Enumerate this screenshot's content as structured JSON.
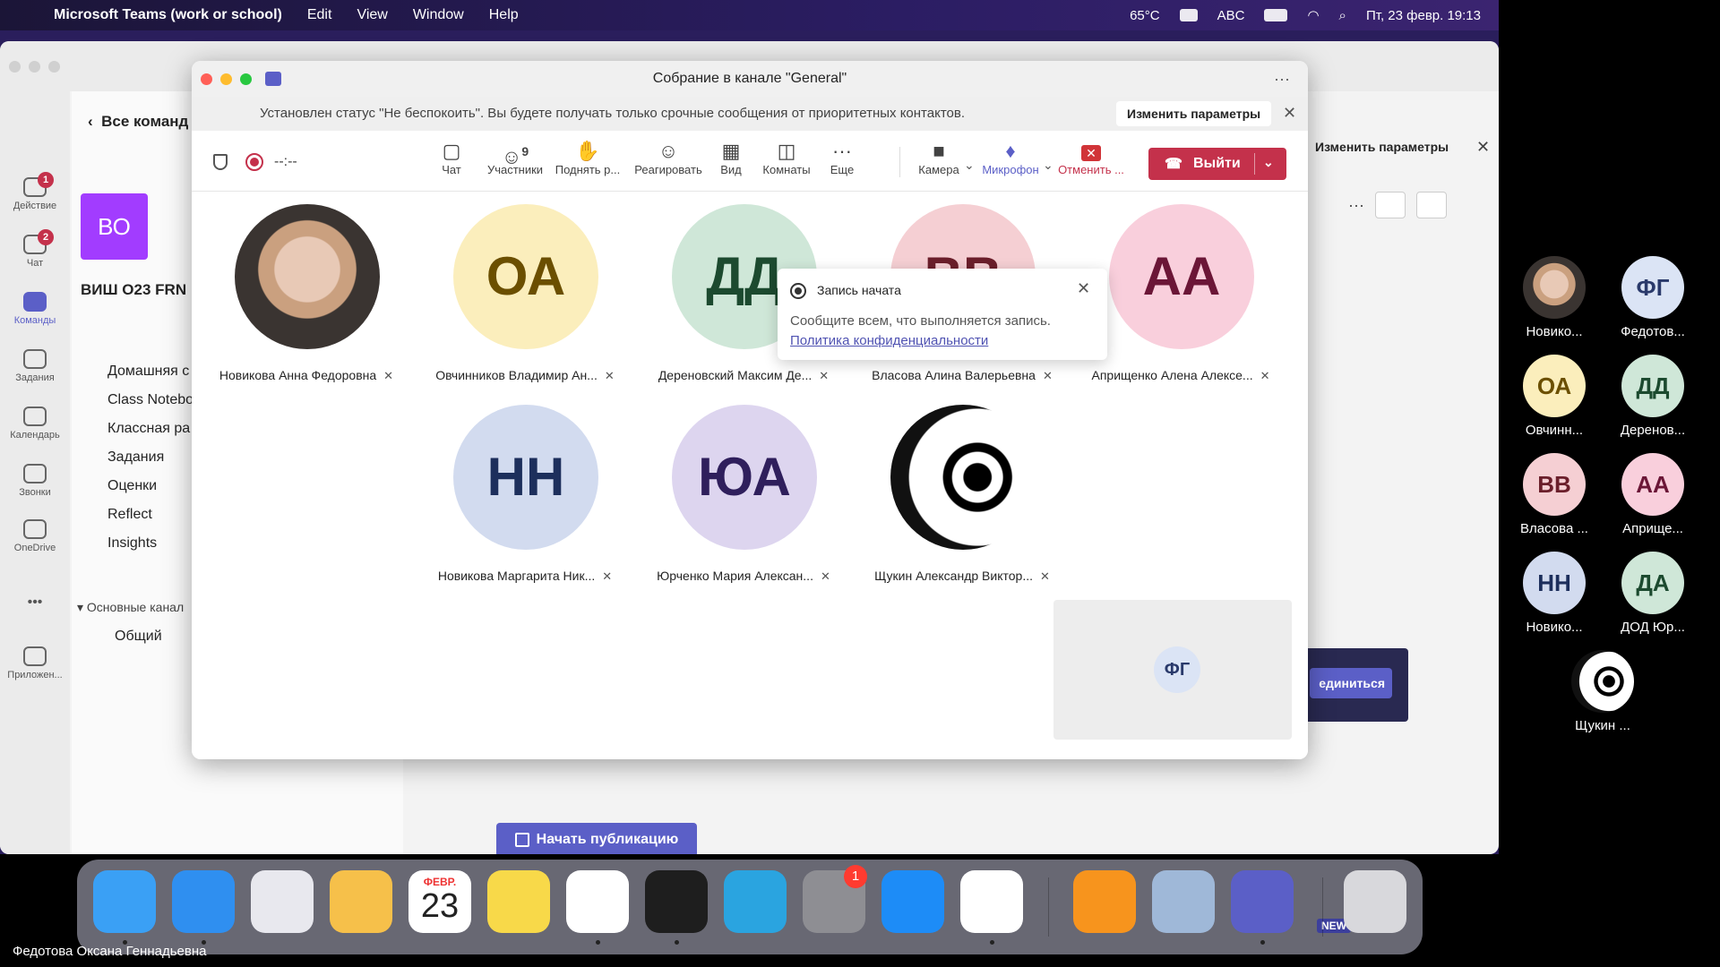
{
  "menubar": {
    "app_name": "Microsoft Teams (work or school)",
    "items": [
      "Edit",
      "View",
      "Window",
      "Help"
    ],
    "temperature": "65°C",
    "input_source": "ABC",
    "datetime": "Пт, 23 февр. 19:13"
  },
  "teams_main": {
    "rail": [
      {
        "label": "Действие",
        "icon": "bell-icon",
        "badge": "1"
      },
      {
        "label": "Чат",
        "icon": "chat-icon",
        "badge": "2"
      },
      {
        "label": "Команды",
        "icon": "teams-icon",
        "badge": ""
      },
      {
        "label": "Задания",
        "icon": "assignments-icon",
        "badge": ""
      },
      {
        "label": "Календарь",
        "icon": "calendar-icon",
        "badge": ""
      },
      {
        "label": "Звонки",
        "icon": "phone-icon",
        "badge": ""
      },
      {
        "label": "OneDrive",
        "icon": "cloud-icon",
        "badge": ""
      },
      {
        "label": "•••",
        "icon": "more-icon",
        "badge": ""
      },
      {
        "label": "Приложен...",
        "icon": "add-apps-icon",
        "badge": ""
      }
    ],
    "back_label": "Все команд",
    "team_avatar": "ВО",
    "team_name": "ВИШ О23 FRN",
    "nav_items": [
      "Домашняя с",
      "Class Notebo",
      "Классная ра",
      "Задания",
      "Оценки",
      "Reflect",
      "Insights"
    ],
    "section_label": "Основные канал",
    "channel": "Общий",
    "publish_button": "Начать публикацию",
    "right_change_params": "Изменить параметры",
    "join_label": "единиться"
  },
  "meeting": {
    "title": "Собрание в канале \"General\"",
    "dnd_message": "Установлен статус \"Не беспокоить\". Вы будете получать только срочные сообщения от приоритетных контактов.",
    "dnd_button": "Изменить параметры",
    "timer": "--:--",
    "toolbar": {
      "chat": "Чат",
      "participants": "Участники",
      "participants_count": "9",
      "raise_hand": "Поднять р...",
      "react": "Реагировать",
      "view": "Вид",
      "rooms": "Комнаты",
      "more": "Еще",
      "camera": "Камера",
      "mic": "Микрофон",
      "cancel": "Отменить ...",
      "leave": "Выйти"
    },
    "recording_popup": {
      "title": "Запись начата",
      "text": "Сообщите всем, что выполняется запись.",
      "link": "Политика конфиденциальности"
    },
    "participants": [
      {
        "initials": "",
        "name": "Новикова Анна Федоровна",
        "bg": "#3a3431",
        "fg": "#3a3431",
        "photo": "woman"
      },
      {
        "initials": "ОА",
        "name": "Овчинников Владимир Ан...",
        "bg": "#fbeebc",
        "fg": "#6b4f00",
        "photo": ""
      },
      {
        "initials": "ДД",
        "name": "Дереновский Максим Де...",
        "bg": "#cfe7d8",
        "fg": "#1c4a2f",
        "photo": ""
      },
      {
        "initials": "ВВ",
        "name": "Власова Алина Валерьевна",
        "bg": "#f5cfd3",
        "fg": "#6b1f2b",
        "photo": ""
      },
      {
        "initials": "АА",
        "name": "Априщенко Алена Алексе...",
        "bg": "#f9cfdc",
        "fg": "#6b1637",
        "photo": ""
      },
      {
        "initials": "НН",
        "name": "Новикова Маргарита Ник...",
        "bg": "#d2dbef",
        "fg": "#1d2f5c",
        "photo": ""
      },
      {
        "initials": "ЮА",
        "name": "Юрченко Мария Алексан...",
        "bg": "#ddd5ef",
        "fg": "#2f1f5c",
        "photo": ""
      },
      {
        "initials": "",
        "name": "Щукин Александр Виктор...",
        "bg": "#ffffff",
        "fg": "#000000",
        "photo": "eye"
      }
    ],
    "self_view": "ФГ"
  },
  "strip": [
    {
      "initials": "",
      "name": "Новико...",
      "bg": "#caa07f",
      "fg": "#333",
      "photo": "woman"
    },
    {
      "initials": "ФГ",
      "name": "Федотов...",
      "bg": "#dbe4f5",
      "fg": "#2a3a6b",
      "photo": ""
    },
    {
      "initials": "ОА",
      "name": "Овчинн...",
      "bg": "#fbeebc",
      "fg": "#6b4f00",
      "photo": ""
    },
    {
      "initials": "ДД",
      "name": "Деренов...",
      "bg": "#cfe7d8",
      "fg": "#1c4a2f",
      "photo": ""
    },
    {
      "initials": "ВВ",
      "name": "Власова ...",
      "bg": "#f5cfd3",
      "fg": "#6b1f2b",
      "photo": ""
    },
    {
      "initials": "АА",
      "name": "Априще...",
      "bg": "#f9cfdc",
      "fg": "#6b1637",
      "photo": ""
    },
    {
      "initials": "НН",
      "name": "Новико...",
      "bg": "#d2dbef",
      "fg": "#1d2f5c",
      "photo": ""
    },
    {
      "initials": "ДА",
      "name": "ДОД Юр...",
      "bg": "#cfe7d8",
      "fg": "#1c4a2f",
      "photo": ""
    },
    {
      "initials": "",
      "name": "Щукин ...",
      "bg": "#ffffff",
      "fg": "#000",
      "photo": "eye"
    }
  ],
  "dock": {
    "apps": [
      {
        "name": "finder-icon",
        "color": "#3aa0f5"
      },
      {
        "name": "safari-icon",
        "color": "#2f8ff0"
      },
      {
        "name": "launchpad-icon",
        "color": "#e8e8ee"
      },
      {
        "name": "photos-icon",
        "color": "#f6c04a"
      },
      {
        "name": "calendar-icon",
        "color": "#ffffff"
      },
      {
        "name": "notes-icon",
        "color": "#f8d949"
      },
      {
        "name": "chrome-icon",
        "color": "#ffffff"
      },
      {
        "name": "terminal-icon",
        "color": "#1e1e1e"
      },
      {
        "name": "telegram-icon",
        "color": "#2aa4e0"
      },
      {
        "name": "system-settings-icon",
        "color": "#8e8e93"
      },
      {
        "name": "app-store-icon",
        "color": "#1d8cf7"
      },
      {
        "name": "vscode-icon",
        "color": "#ffffff"
      },
      {
        "name": "pages-icon",
        "color": "#f7941d"
      },
      {
        "name": "preview-icon",
        "color": "#9fb8d8"
      },
      {
        "name": "teams-icon",
        "color": "#5b5fc7"
      },
      {
        "name": "trash-icon",
        "color": "#d8d8dc"
      }
    ],
    "calendar_month": "ФЕВР.",
    "calendar_day": "23",
    "settings_badge": "1",
    "teams_tag": "NEW"
  },
  "caption": "Федотова Оксана Геннадьевна"
}
